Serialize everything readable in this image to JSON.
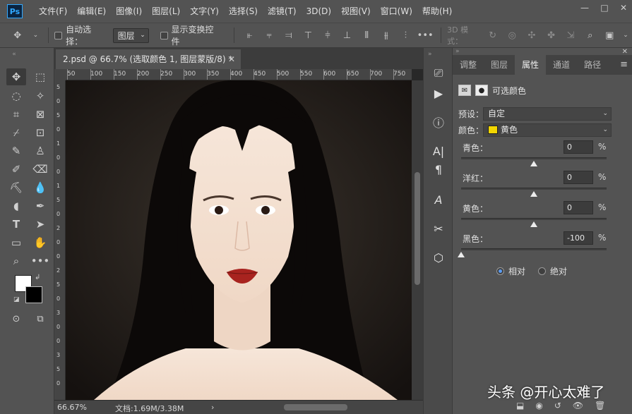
{
  "app": {
    "logo": "Ps"
  },
  "menu": [
    "文件(F)",
    "编辑(E)",
    "图像(I)",
    "图层(L)",
    "文字(Y)",
    "选择(S)",
    "滤镜(T)",
    "3D(D)",
    "视图(V)",
    "窗口(W)",
    "帮助(H)"
  ],
  "window_controls": {
    "minimize": "—",
    "restore": "□",
    "close": "✕"
  },
  "options_bar": {
    "auto_select_label": "自动选择：",
    "auto_select_target": "图层",
    "show_transform_label": "显示变换控件",
    "mode_3d_label": "3D 模式："
  },
  "document": {
    "tab_title": "2.psd @ 66.7% (选取颜色 1, 图层蒙版/8) *",
    "ruler_top": [
      "50",
      "100",
      "150",
      "200",
      "250",
      "300",
      "350",
      "400",
      "450",
      "500",
      "550",
      "600",
      "650",
      "700",
      "750"
    ],
    "ruler_left": [
      "5",
      "0",
      "5",
      "0",
      "1",
      "0",
      "0",
      "1",
      "5",
      "0",
      "2",
      "0",
      "0",
      "2",
      "5",
      "0",
      "3",
      "0",
      "0",
      "3",
      "5",
      "0"
    ]
  },
  "status": {
    "zoom": "66.67%",
    "doc_size": "文档:1.69M/3.38M",
    "arrow": "›"
  },
  "panel": {
    "tabs": [
      "调整",
      "图层",
      "属性",
      "通道",
      "路径"
    ],
    "active_tab": "属性",
    "header_title": "可选颜色",
    "preset_label": "预设：",
    "preset_value": "自定",
    "color_label": "颜色：",
    "color_value": "黄色",
    "color_swatch": "#f2d600",
    "sliders": [
      {
        "label": "青色：",
        "value": "0",
        "unit": "%",
        "level": 0
      },
      {
        "label": "洋红：",
        "value": "0",
        "unit": "%",
        "level": 0
      },
      {
        "label": "黄色：",
        "value": "0",
        "unit": "%",
        "level": 0
      },
      {
        "label": "黑色：",
        "value": "-100",
        "unit": "%",
        "level": -100
      }
    ],
    "mode_relative": "相对",
    "mode_absolute": "绝对",
    "mode_selected": "相对"
  },
  "watermark": "头条 @开心太难了"
}
